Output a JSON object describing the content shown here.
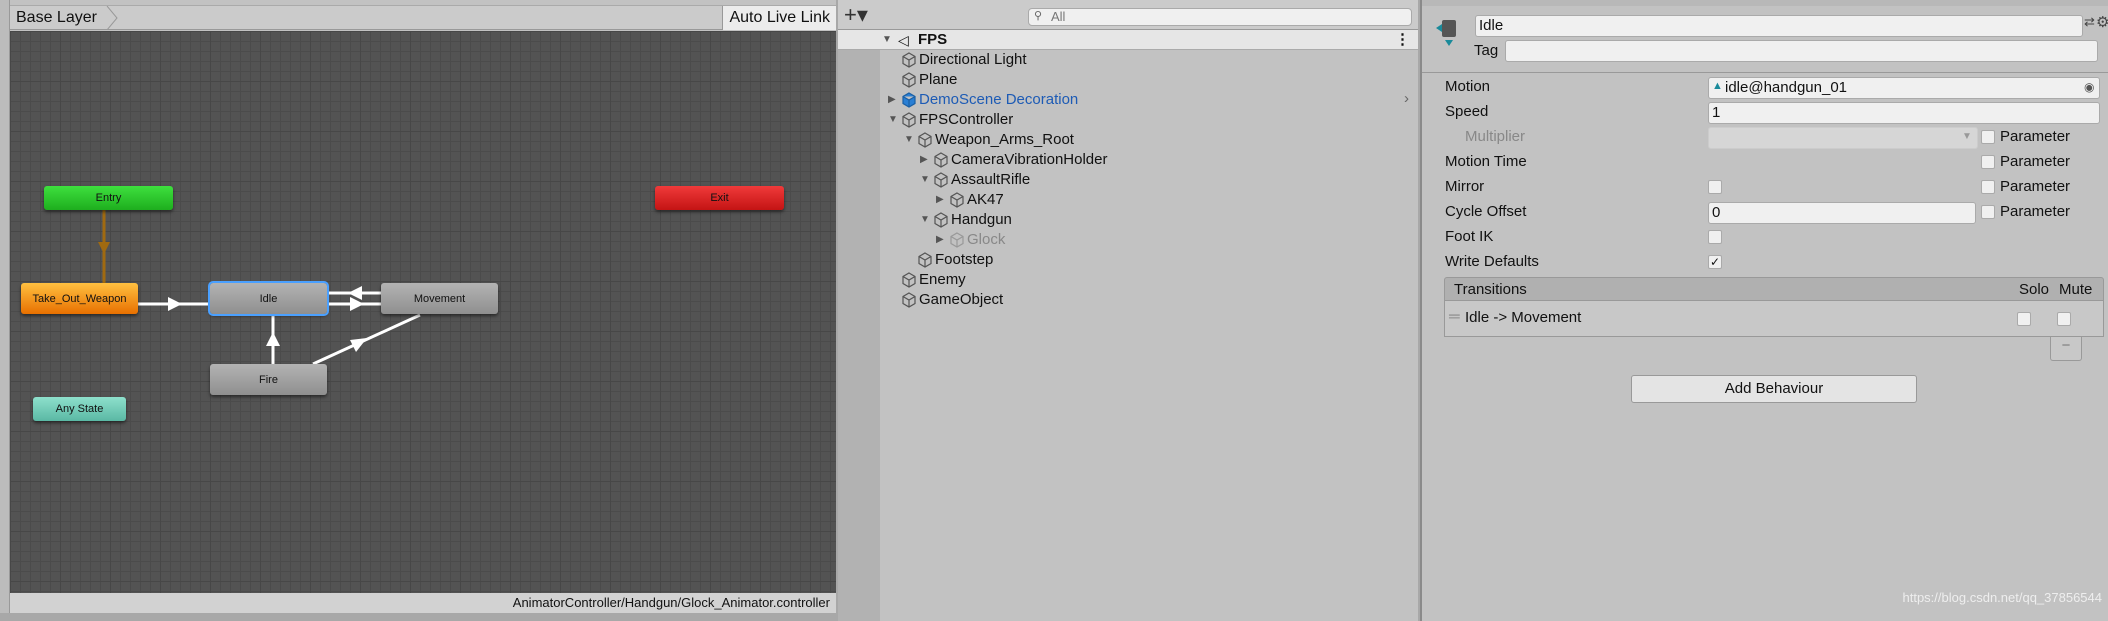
{
  "animator": {
    "breadcrumb": "Base Layer",
    "auto_live_link": "Auto Live Link",
    "status_path": "AnimatorController/Handgun/Glock_Animator.controller",
    "states": {
      "entry": "Entry",
      "exit": "Exit",
      "take_out": "Take_Out_Weapon",
      "idle": "Idle",
      "movement": "Movement",
      "fire": "Fire",
      "any_state": "Any State"
    },
    "colors": {
      "entry": "#22c022",
      "exit": "#d42020",
      "take_out": "#f08a10",
      "any_state": "#70cdb8",
      "selected_outline": "#4aa0ff"
    },
    "transitions": [
      [
        "Entry",
        "Take_Out_Weapon"
      ],
      [
        "Take_Out_Weapon",
        "Idle"
      ],
      [
        "Idle",
        "Movement"
      ],
      [
        "Movement",
        "Idle"
      ],
      [
        "Fire",
        "Idle"
      ],
      [
        "Fire",
        "Movement"
      ]
    ]
  },
  "hierarchy": {
    "search_placeholder": "All",
    "scene": "FPS",
    "items": [
      {
        "label": "Directional Light",
        "depth": 1,
        "arrow": ""
      },
      {
        "label": "Plane",
        "depth": 1,
        "arrow": ""
      },
      {
        "label": "DemoScene Decoration",
        "depth": 1,
        "arrow": "collapsed",
        "prefab": true
      },
      {
        "label": "FPSController",
        "depth": 1,
        "arrow": "expanded"
      },
      {
        "label": "Weapon_Arms_Root",
        "depth": 2,
        "arrow": "expanded"
      },
      {
        "label": "CameraVibrationHolder",
        "depth": 3,
        "arrow": "collapsed"
      },
      {
        "label": "AssaultRifle",
        "depth": 3,
        "arrow": "expanded"
      },
      {
        "label": "AK47",
        "depth": 4,
        "arrow": "collapsed"
      },
      {
        "label": "Handgun",
        "depth": 3,
        "arrow": "expanded"
      },
      {
        "label": "Glock",
        "depth": 4,
        "arrow": "collapsed",
        "inactive": true
      },
      {
        "label": "Footstep",
        "depth": 2,
        "arrow": ""
      },
      {
        "label": "Enemy",
        "depth": 1,
        "arrow": ""
      },
      {
        "label": "GameObject",
        "depth": 1,
        "arrow": ""
      }
    ]
  },
  "inspector": {
    "name": "Idle",
    "tag_label": "Tag",
    "tag_value": "",
    "motion_label": "Motion",
    "motion_value": "idle@handgun_01",
    "speed_label": "Speed",
    "speed_value": "1",
    "multiplier_label": "Multiplier",
    "parameter_label": "Parameter",
    "motion_time_label": "Motion Time",
    "mirror_label": "Mirror",
    "cycle_offset_label": "Cycle Offset",
    "cycle_offset_value": "0",
    "foot_ik_label": "Foot IK",
    "write_defaults_label": "Write Defaults",
    "mirror": false,
    "foot_ik": false,
    "write_defaults": true,
    "transitions_header": "Transitions",
    "solo_label": "Solo",
    "mute_label": "Mute",
    "transition_item": "Idle -> Movement",
    "minus": "−",
    "add_behaviour": "Add Behaviour",
    "check": "✓"
  },
  "watermark": "https://blog.csdn.net/qq_37856544"
}
